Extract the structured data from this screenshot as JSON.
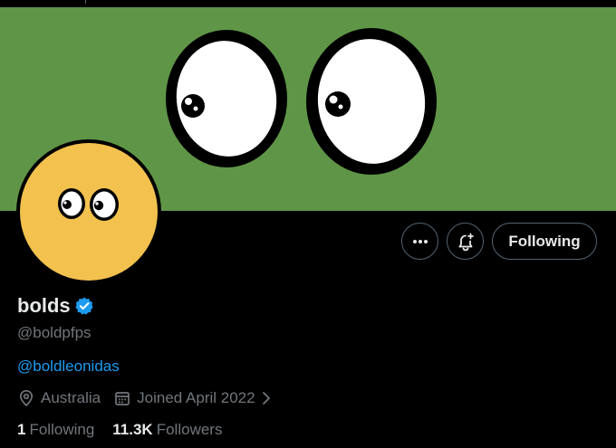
{
  "profile": {
    "display_name": "bolds",
    "handle": "@boldpfps",
    "bio_link": "@boldleonidas",
    "location": "Australia",
    "joined": "Joined April 2022",
    "following_count": "1",
    "following_label": "Following",
    "followers_count": "11.3K",
    "followers_label": "Followers"
  },
  "actions": {
    "follow_state_label": "Following"
  },
  "colors": {
    "banner": "#5f9547",
    "avatar": "#f2c14e",
    "link": "#1d9bf0",
    "verified": "#1d9bf0",
    "muted_text": "#71767b",
    "primary_text": "#e7e9ea"
  },
  "icons": {
    "more": "more-horizontal-icon",
    "notify": "bell-plus-icon",
    "verified": "verified-badge-icon",
    "location": "location-pin-icon",
    "calendar": "calendar-icon",
    "chevron": "chevron-right-icon"
  }
}
